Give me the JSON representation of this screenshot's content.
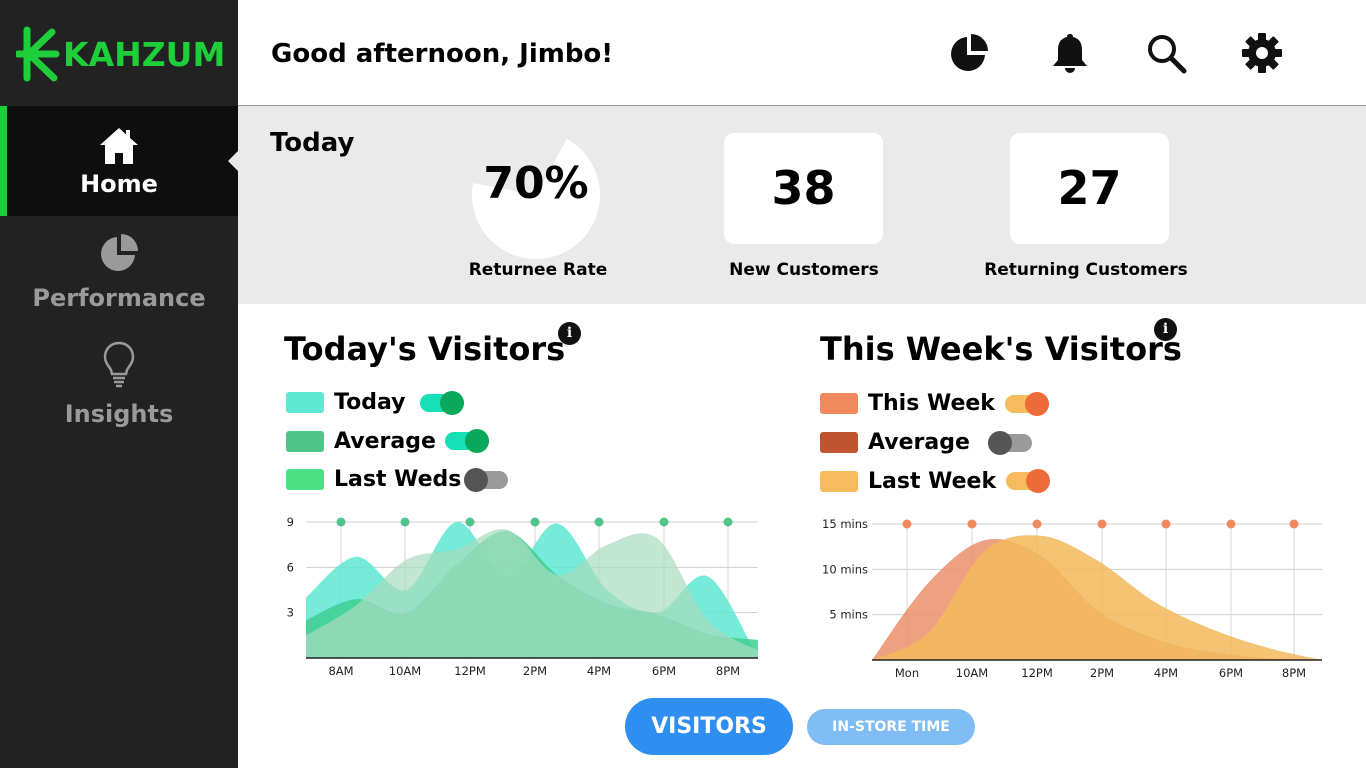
{
  "brand": {
    "name": "KAHZUM",
    "color": "#1ecf3a"
  },
  "sidebar": {
    "items": [
      {
        "label": "Home",
        "icon": "home-icon",
        "active": true
      },
      {
        "label": "Performance",
        "icon": "pie-chart-icon",
        "active": false
      },
      {
        "label": "Insights",
        "icon": "lightbulb-icon",
        "active": false
      }
    ]
  },
  "header": {
    "greeting": "Good afternoon, Jimbo!",
    "icons": [
      "pie-chart-icon",
      "bell-icon",
      "search-icon",
      "gear-icon"
    ]
  },
  "today": {
    "title": "Today",
    "returnee_rate": {
      "value": "70%",
      "fraction": 0.7,
      "label": "Returnee Rate"
    },
    "new_customers": {
      "value": "38",
      "label": "New Customers"
    },
    "returning_customers": {
      "value": "27",
      "label": "Returning Customers"
    }
  },
  "charts": {
    "today": {
      "title": "Today's Visitors",
      "legend": [
        {
          "label": "Today",
          "color": "#5ee8d2",
          "toggle": "on"
        },
        {
          "label": "Average",
          "color": "#4fc58a",
          "toggle": "on"
        },
        {
          "label": "Last Weds",
          "color": "#4ee085",
          "toggle": "off"
        }
      ]
    },
    "week": {
      "title": "This Week's Visitors",
      "legend": [
        {
          "label": "This Week",
          "color": "#f08a5e",
          "toggle": "on"
        },
        {
          "label": "Average",
          "color": "#bf5530",
          "toggle": "off"
        },
        {
          "label": "Last Week",
          "color": "#f6bb5c",
          "toggle": "on"
        }
      ]
    }
  },
  "chart_data": [
    {
      "type": "area",
      "title": "Today's Visitors",
      "x": [
        "8AM",
        "10AM",
        "12PM",
        "2PM",
        "4PM",
        "6PM",
        "8PM"
      ],
      "ylim": [
        0,
        9
      ],
      "yticks": [
        "9",
        "6",
        "3"
      ],
      "grid": true,
      "series": [
        {
          "name": "Today",
          "color": "#5ee8d2",
          "values": [
            4,
            6.7,
            4.5,
            9,
            5.4,
            8.9,
            4.5,
            3,
            5.4,
            0
          ]
        },
        {
          "name": "Average",
          "color": "#3ecf92",
          "values": [
            2.5,
            3.9,
            3,
            6.2,
            8.4,
            5.5,
            3.6,
            2.9,
            1.6,
            1.2
          ]
        },
        {
          "name": "Last Weds",
          "color": "#a8dcbf",
          "values": [
            1.5,
            3.5,
            6.5,
            7.2,
            8.5,
            5.5,
            7.5,
            7.9,
            2.5,
            0.5
          ]
        }
      ],
      "markers_at": 9
    },
    {
      "type": "area",
      "title": "This Week's Visitors",
      "x": [
        "Mon",
        "10AM",
        "12PM",
        "2PM",
        "4PM",
        "6PM",
        "8PM"
      ],
      "ylim": [
        0,
        15
      ],
      "yticks": [
        "15 mins",
        "10 mins",
        "5 mins"
      ],
      "grid": true,
      "series": [
        {
          "name": "This Week",
          "color": "#ec8f6a",
          "values": [
            0,
            8.5,
            13.2,
            11.5,
            5.5,
            2.4,
            0.9,
            0.2,
            0
          ]
        },
        {
          "name": "Last Week",
          "color": "#f2b85a",
          "values": [
            0,
            3,
            12,
            13.7,
            11,
            6.5,
            3.5,
            1.4,
            0
          ]
        }
      ],
      "markers_at": 15
    }
  ],
  "buttons": {
    "visitors": "VISITORS",
    "instore": "IN-STORE TIME"
  }
}
